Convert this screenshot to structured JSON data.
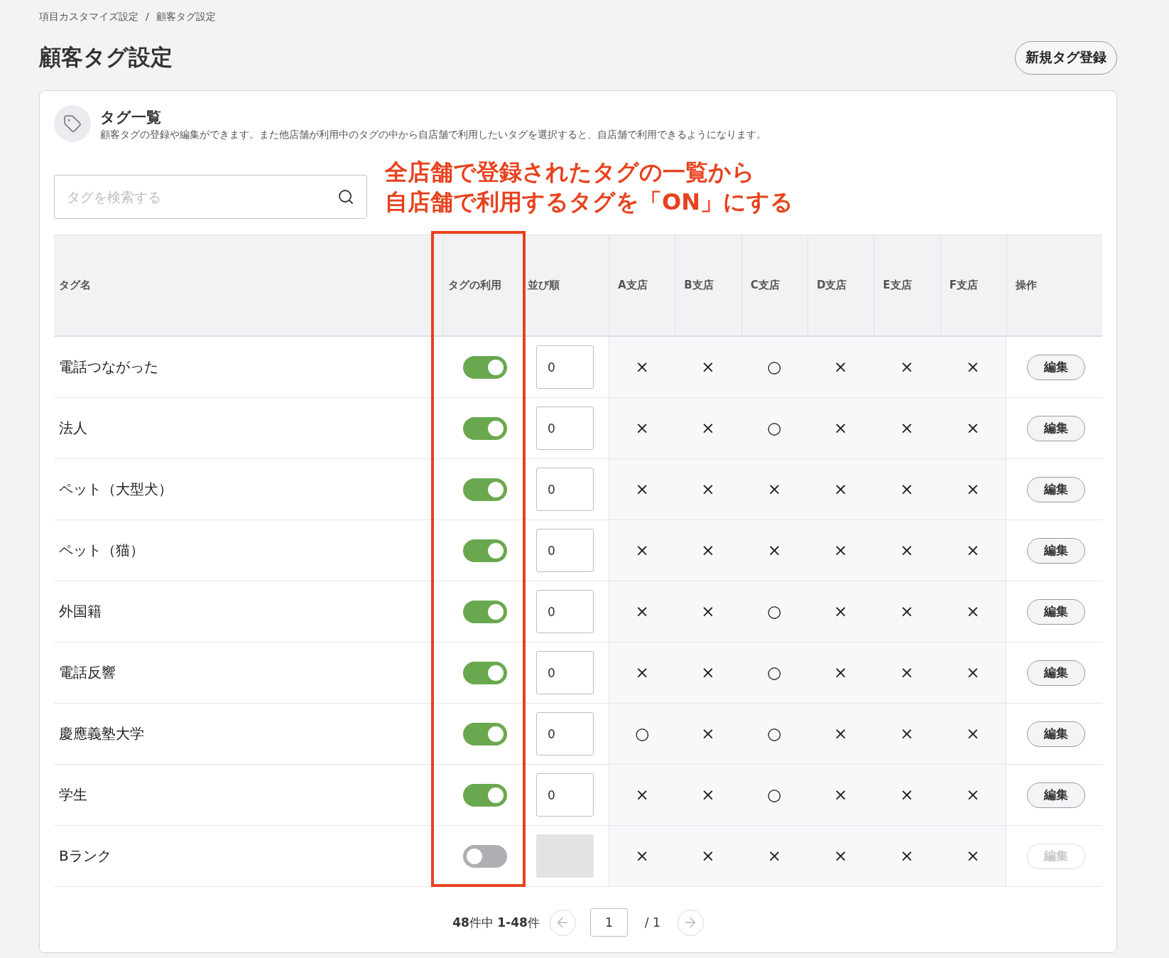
{
  "breadcrumb": {
    "items": [
      "項目カスタマイズ設定",
      "顧客タグ設定"
    ],
    "separator": "/"
  },
  "page": {
    "title": "顧客タグ設定",
    "new_button": "新規タグ登録"
  },
  "panel": {
    "title": "タグ一覧",
    "description": "顧客タグの登録や編集ができます。また他店舗が利用中のタグの中から自店舗で利用したいタグを選択すると、自店舗で利用できるようになります。"
  },
  "search": {
    "placeholder": "タグを検索する"
  },
  "annotation": {
    "lines": [
      "全店舗で登録されたタグの一覧から",
      "自店舗で利用するタグを「ON」にする"
    ]
  },
  "table": {
    "columns": [
      "タグ名",
      "タグの利用",
      "並び順",
      "A支店",
      "B支店",
      "C支店",
      "D支店",
      "E支店",
      "F支店",
      "操作"
    ],
    "rows": [
      {
        "name": "電話つながった",
        "on": true,
        "order": "0",
        "branches": [
          "×",
          "×",
          "○",
          "×",
          "×",
          "×"
        ],
        "action": "編集"
      },
      {
        "name": "法人",
        "on": true,
        "order": "0",
        "branches": [
          "×",
          "×",
          "○",
          "×",
          "×",
          "×"
        ],
        "action": "編集"
      },
      {
        "name": "ペット（大型犬）",
        "on": true,
        "order": "0",
        "branches": [
          "×",
          "×",
          "×",
          "×",
          "×",
          "×"
        ],
        "action": "編集"
      },
      {
        "name": "ペット（猫）",
        "on": true,
        "order": "0",
        "branches": [
          "×",
          "×",
          "×",
          "×",
          "×",
          "×"
        ],
        "action": "編集"
      },
      {
        "name": "外国籍",
        "on": true,
        "order": "0",
        "branches": [
          "×",
          "×",
          "○",
          "×",
          "×",
          "×"
        ],
        "action": "編集"
      },
      {
        "name": "電話反響",
        "on": true,
        "order": "0",
        "branches": [
          "×",
          "×",
          "○",
          "×",
          "×",
          "×"
        ],
        "action": "編集"
      },
      {
        "name": "慶應義塾大学",
        "on": true,
        "order": "0",
        "branches": [
          "○",
          "×",
          "○",
          "×",
          "×",
          "×"
        ],
        "action": "編集"
      },
      {
        "name": "学生",
        "on": true,
        "order": "0",
        "branches": [
          "×",
          "×",
          "○",
          "×",
          "×",
          "×"
        ],
        "action": "編集"
      },
      {
        "name": "Bランク",
        "on": false,
        "branches": [
          "×",
          "×",
          "×",
          "×",
          "×",
          "×"
        ],
        "action": "編集"
      }
    ]
  },
  "pagination": {
    "summary": "**48**件中 **1-48**件",
    "page": "1",
    "total": "/ 1"
  }
}
